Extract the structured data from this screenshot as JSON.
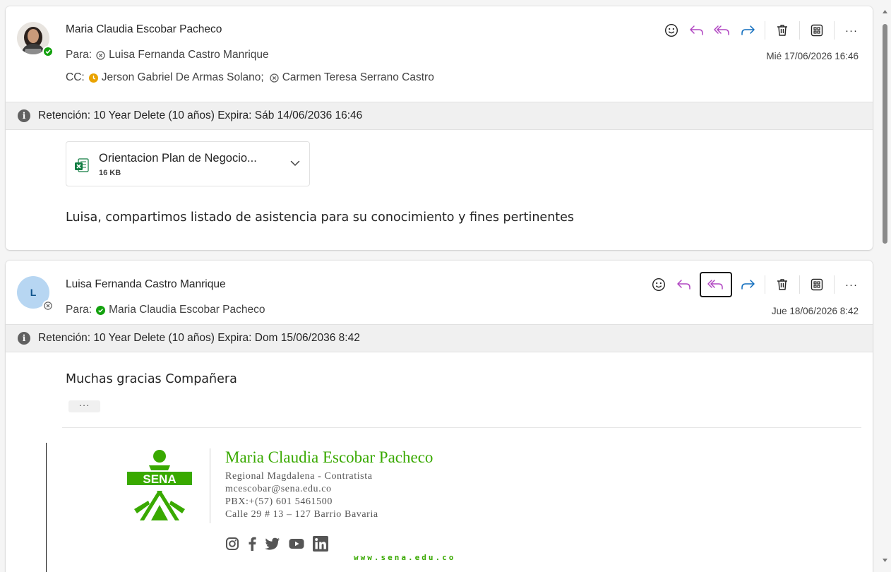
{
  "message1": {
    "sender": "Maria Claudia Escobar Pacheco",
    "to_label": "Para:",
    "to": [
      "Luisa Fernanda Castro Manrique"
    ],
    "cc_label": "CC:",
    "cc": [
      "Jerson Gabriel De Armas Solano;",
      "Carmen Teresa Serrano Castro"
    ],
    "date": "Mié 17/06/2026 16:46",
    "retention": "Retención: 10 Year Delete (10 años) Expira: Sáb 14/06/2036 16:46",
    "attachment": {
      "name": "Orientacion Plan de Negocio...",
      "size": "16 KB"
    },
    "body": "Luisa, compartimos listado de asistencia para su conocimiento y fines pertinentes"
  },
  "message2": {
    "sender": "Luisa Fernanda Castro Manrique",
    "avatar_initial": "L",
    "to_label": "Para:",
    "to": [
      "Maria Claudia Escobar Pacheco"
    ],
    "date": "Jue 18/06/2026 8:42",
    "retention": "Retención: 10 Year Delete (10 años) Expira: Dom 15/06/2036 8:42",
    "body": "Muchas gracias Compañera",
    "expand_label": "···",
    "signature": {
      "name": "Maria Claudia Escobar Pacheco",
      "role": "Regional Magdalena - Contratista",
      "email": "mcescobar@sena.edu.co",
      "phone": "PBX:+(57) 601 5461500",
      "address": "Calle 29 # 13 – 127 Barrio Bavaria",
      "logo_text": "SENA",
      "website": "www.sena.edu.co"
    }
  },
  "toolbar": {
    "icons": [
      "emoji-react-icon",
      "reply-icon",
      "reply-all-icon",
      "forward-icon",
      "delete-icon",
      "apps-icon",
      "more-icon"
    ],
    "more_label": "···"
  },
  "colors": {
    "reply": "#b146c2",
    "forward": "#0f6cbd",
    "presence_available": "#13a10e",
    "presence_away": "#eaa300",
    "sena_green": "#39a900"
  }
}
